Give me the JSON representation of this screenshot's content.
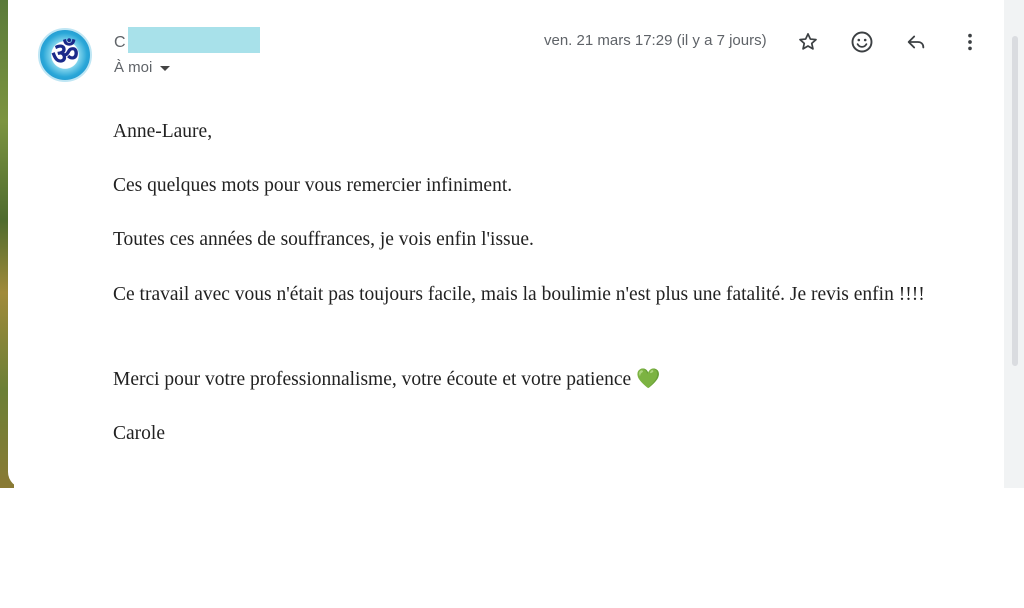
{
  "email": {
    "sender_initial": "C",
    "recipient_label": "À moi",
    "date": "ven. 21 mars 17:29 (il y a 7 jours)",
    "avatar_glyph": "ॐ"
  },
  "actions": {
    "star_icon": "star-icon",
    "emoji_icon": "emoji-icon",
    "reply_icon": "reply-icon",
    "more_icon": "more-vert-icon"
  },
  "body": {
    "greeting": "Anne-Laure,",
    "para1": "Ces quelques mots pour vous remercier infiniment.",
    "para2": "Toutes ces années de souffrances, je vois enfin l'issue.",
    "para3": "Ce travail avec vous n'était pas toujours facile, mais la boulimie n'est plus une fatalité. Je revis enfin !!!!",
    "para4": "Merci pour votre professionnalisme, votre écoute et votre patience",
    "heart": "💚",
    "signature": "Carole"
  },
  "colors": {
    "accent": "#a8e1ea",
    "icon": "#3c4043",
    "heart": "#4cb050"
  }
}
